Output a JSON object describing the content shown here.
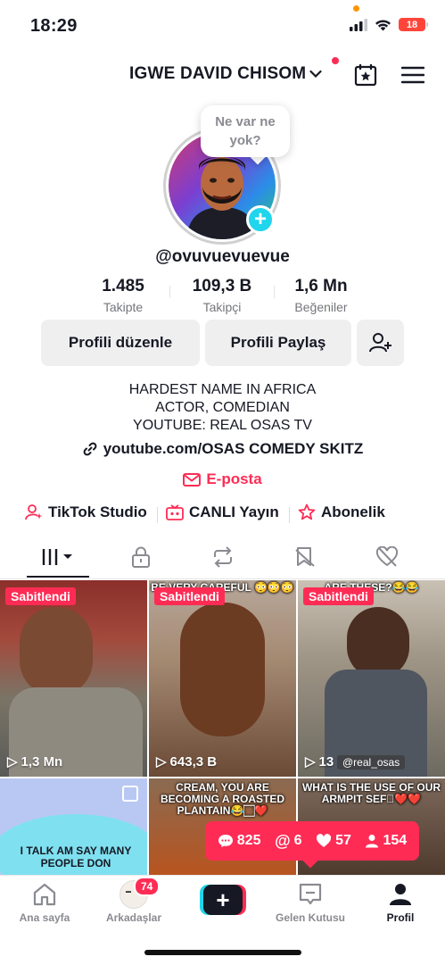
{
  "status_bar": {
    "time": "18:29",
    "battery": "18"
  },
  "header": {
    "profile_name": "IGWE DAVID CHISOM"
  },
  "avatar_bubble": {
    "line1": "Ne var ne",
    "line2": "yok?"
  },
  "profile": {
    "username": "@ovuvuevuevue"
  },
  "stats": [
    {
      "value": "1.485",
      "label": "Takipte"
    },
    {
      "value": "109,3 B",
      "label": "Takipçi"
    },
    {
      "value": "1,6 Mn",
      "label": "Beğeniler"
    }
  ],
  "buttons": {
    "edit": "Profili düzenle",
    "share": "Profili Paylaş"
  },
  "bio": {
    "line1": "HARDEST NAME IN AFRICA",
    "line2": "ACTOR, COMEDIAN",
    "line3": "YOUTUBE: REAL OSAS TV"
  },
  "link": "youtube.com/OSAS COMEDY SKITZ",
  "email": "E-posta",
  "quick_links": {
    "studio": "TikTok Studio",
    "live": "CANLI Yayın",
    "subs": "Abonelik"
  },
  "videos": [
    {
      "pinned": "Sabitlendi",
      "views": "1,3 Mn",
      "caption": ""
    },
    {
      "pinned": "Sabitlendi",
      "views": "643,3 B",
      "caption": "BE VERY CAREFUL 😳😳😳"
    },
    {
      "pinned": "Sabitlendi",
      "views": "13",
      "caption": "ARE THESE?😂😂",
      "tag": "@real_osas"
    },
    {
      "caption": "I TALK AM SAY MANY PEOPLE DON"
    },
    {
      "caption": "CREAM, YOU ARE BECOMING A ROASTED PLANTAIN😂🏻❤️"
    },
    {
      "caption": "WHAT IS THE USE OF OUR ARMPIT SEF🏾❤️❤️"
    }
  ],
  "notif_summary": {
    "comments": "825",
    "mentions": "6",
    "likes": "57",
    "followers": "154"
  },
  "nav": {
    "home": "Ana sayfa",
    "friends": "Arkadaşlar",
    "friends_badge": "74",
    "inbox": "Gelen Kutusu",
    "profile": "Profil"
  },
  "colors": {
    "accent": "#fe2c55",
    "cyan": "#20d5ec"
  }
}
